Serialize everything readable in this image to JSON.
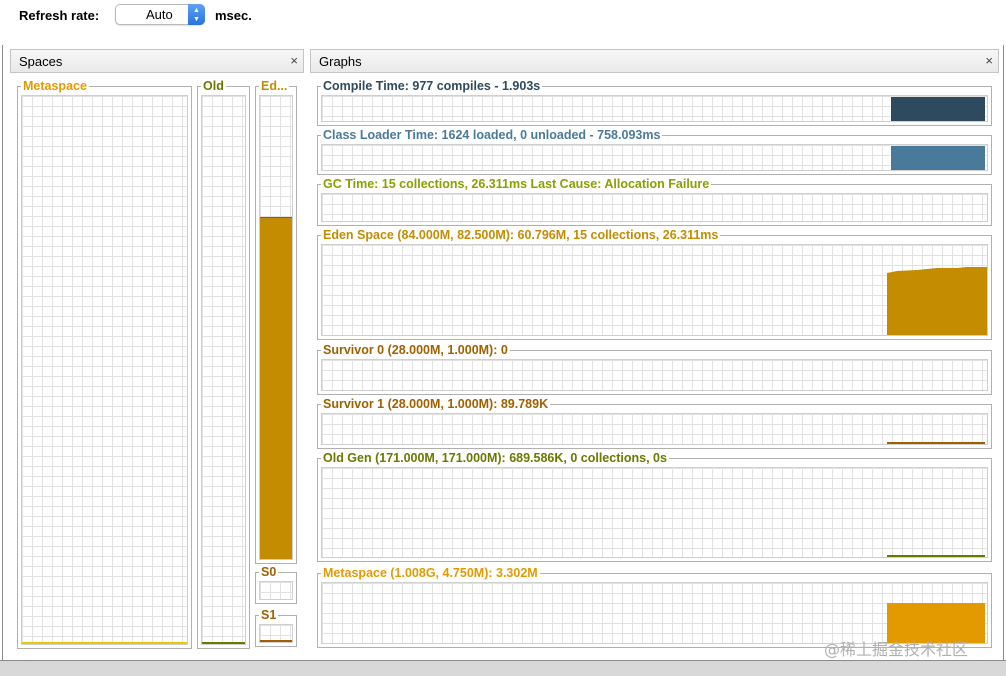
{
  "toolbar": {
    "refresh_label": "Refresh rate:",
    "refresh_value": "Auto",
    "unit_label": "msec."
  },
  "spaces_panel": {
    "title": "Spaces",
    "close": "×",
    "metaspace": "Metaspace",
    "old": "Old",
    "eden": "Ed...",
    "s0": "S0",
    "s1": "S1"
  },
  "graphs_panel": {
    "title": "Graphs",
    "close": "×",
    "compile_time": "Compile Time: 977 compiles - 1.903s",
    "class_loader": "Class Loader Time: 1624 loaded, 0 unloaded - 758.093ms",
    "gc_time": "GC Time: 15 collections, 26.311ms Last Cause: Allocation Failure",
    "eden_space": "Eden Space (84.000M, 82.500M): 60.796M, 15 collections, 26.311ms",
    "survivor0": "Survivor 0 (28.000M, 1.000M): 0",
    "survivor1": "Survivor 1 (28.000M, 1.000M): 89.789K",
    "old_gen": "Old Gen (171.000M, 171.000M): 689.586K, 0 collections, 0s",
    "metaspace": "Metaspace (1.008G, 4.750M): 3.302M"
  },
  "colors": {
    "compile": "#2e4a5e",
    "class_loader": "#4a7a9a",
    "gc": "#8aa000",
    "eden": "#c48c00",
    "survivor": "#a06000",
    "old": "#6a7a00",
    "metaspace": "#e39a00"
  },
  "watermark": "@稀土掘金技术社区"
}
